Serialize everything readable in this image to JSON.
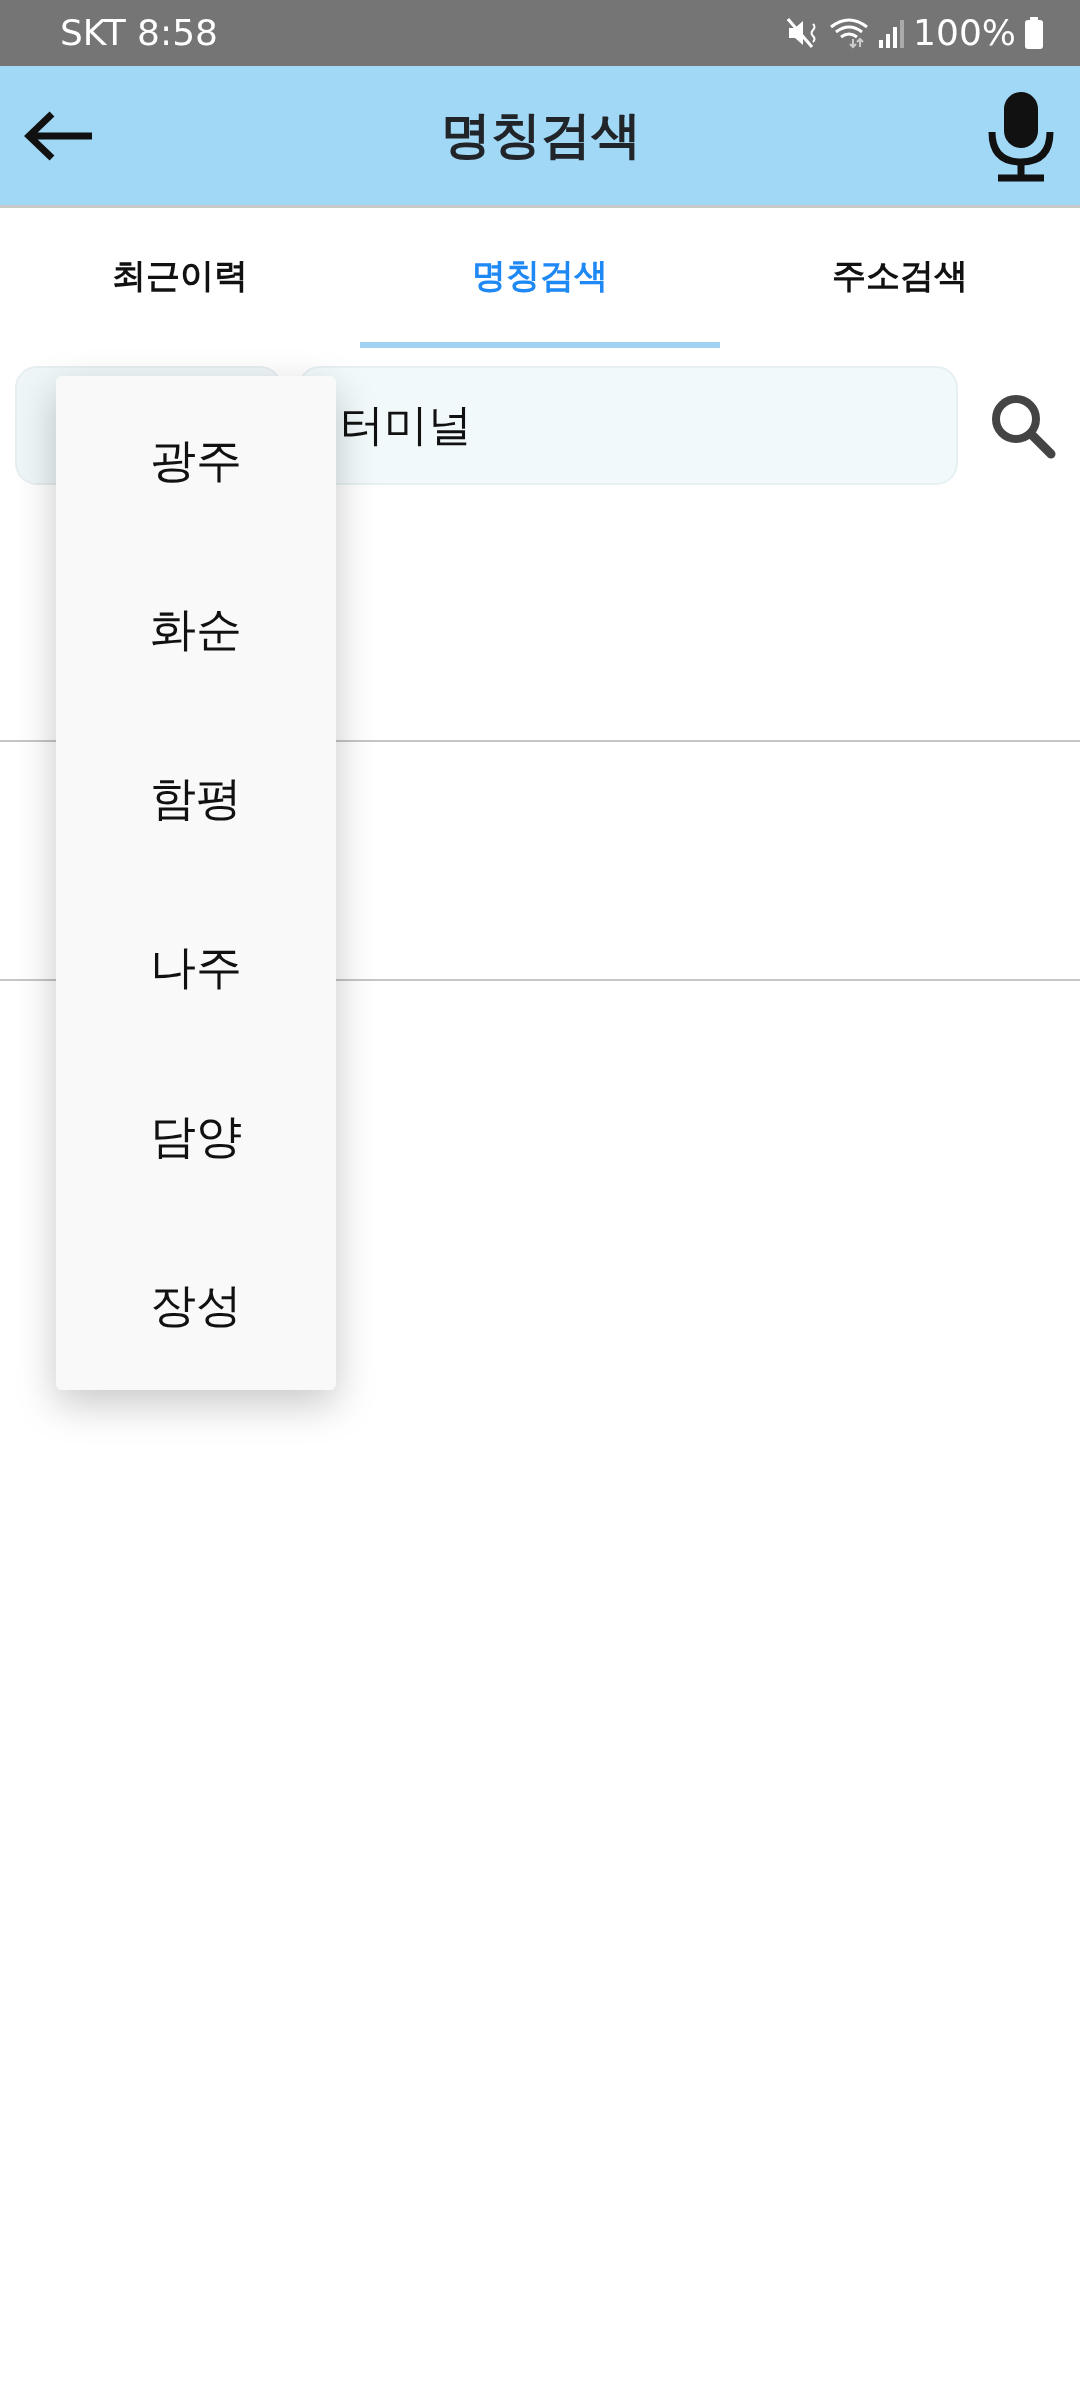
{
  "status_bar": {
    "carrier_time": "SKT 8:58",
    "battery": "100%"
  },
  "header": {
    "title": "명칭검색"
  },
  "tabs": [
    {
      "label": "최근이력",
      "selected": false
    },
    {
      "label": "명칭검색",
      "selected": true
    },
    {
      "label": "주소검색",
      "selected": false
    }
  ],
  "search": {
    "value": "터미널"
  },
  "result_rows": [
    {
      "kind": "row"
    },
    {
      "kind": "row"
    }
  ],
  "dropdown": {
    "items": [
      "광주",
      "화순",
      "함평",
      "나주",
      "담양",
      "장성"
    ]
  }
}
